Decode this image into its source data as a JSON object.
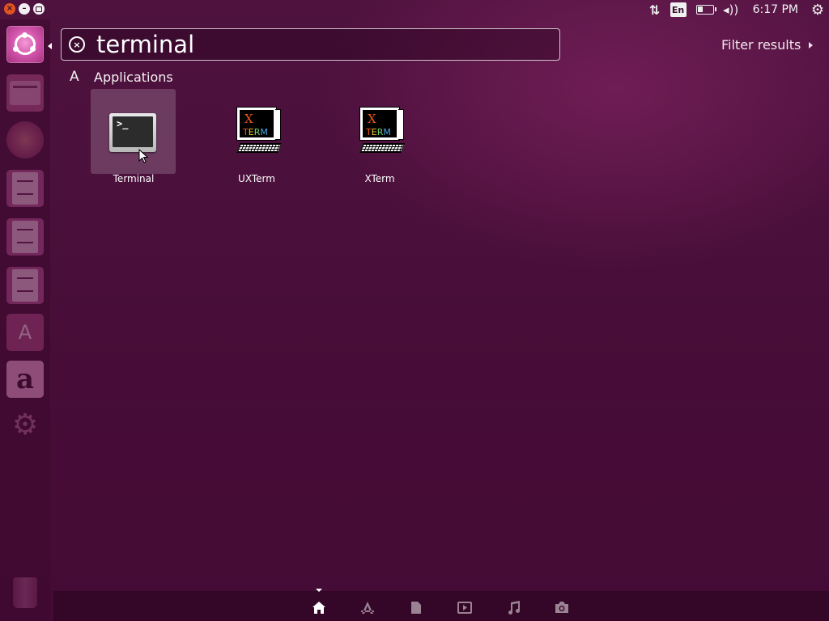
{
  "window_controls": {
    "close_glyph": "×",
    "minimize_glyph": "–"
  },
  "panel": {
    "keyboard_layout": "En",
    "time": "6:17 PM",
    "network_glyph": "⇅",
    "volume_glyph": "◂))",
    "session_glyph": "⚙"
  },
  "launcher": {
    "items": [
      {
        "name": "dash-home",
        "icon": "ubuntu-logo-icon"
      },
      {
        "name": "files",
        "icon": "folder-icon"
      },
      {
        "name": "firefox",
        "icon": "firefox-icon"
      },
      {
        "name": "writer",
        "icon": "document-icon"
      },
      {
        "name": "calc",
        "icon": "spreadsheet-icon"
      },
      {
        "name": "impress",
        "icon": "presentation-icon"
      },
      {
        "name": "software-center",
        "icon": "software-center-icon"
      },
      {
        "name": "amazon",
        "icon": "amazon-icon",
        "glyph": "a"
      },
      {
        "name": "system-settings",
        "icon": "settings-icon",
        "glyph": "⚙"
      },
      {
        "name": "trash",
        "icon": "trash-icon"
      }
    ]
  },
  "search": {
    "value": "terminal",
    "clear_glyph": "×"
  },
  "filter": {
    "label": "Filter results"
  },
  "category": {
    "label": "Applications",
    "icon_glyph": "A"
  },
  "results": [
    {
      "label": "Terminal",
      "icon": "terminal-icon",
      "prompt": ">_"
    },
    {
      "label": "UXTerm",
      "icon": "xterm-icon",
      "x_glyph": "X",
      "term_text": "TERM"
    },
    {
      "label": "XTerm",
      "icon": "xterm-icon",
      "x_glyph": "X",
      "term_text": "TERM"
    }
  ],
  "xterm_colors": [
    "#e8581c",
    "#f2c12e",
    "#6fd36b",
    "#4aa8e8"
  ],
  "lenses": [
    {
      "name": "home",
      "icon": "home-icon",
      "active": true
    },
    {
      "name": "applications",
      "icon": "applications-icon"
    },
    {
      "name": "files",
      "icon": "files-icon"
    },
    {
      "name": "video",
      "icon": "video-icon"
    },
    {
      "name": "music",
      "icon": "music-icon"
    },
    {
      "name": "photos",
      "icon": "camera-icon"
    }
  ]
}
